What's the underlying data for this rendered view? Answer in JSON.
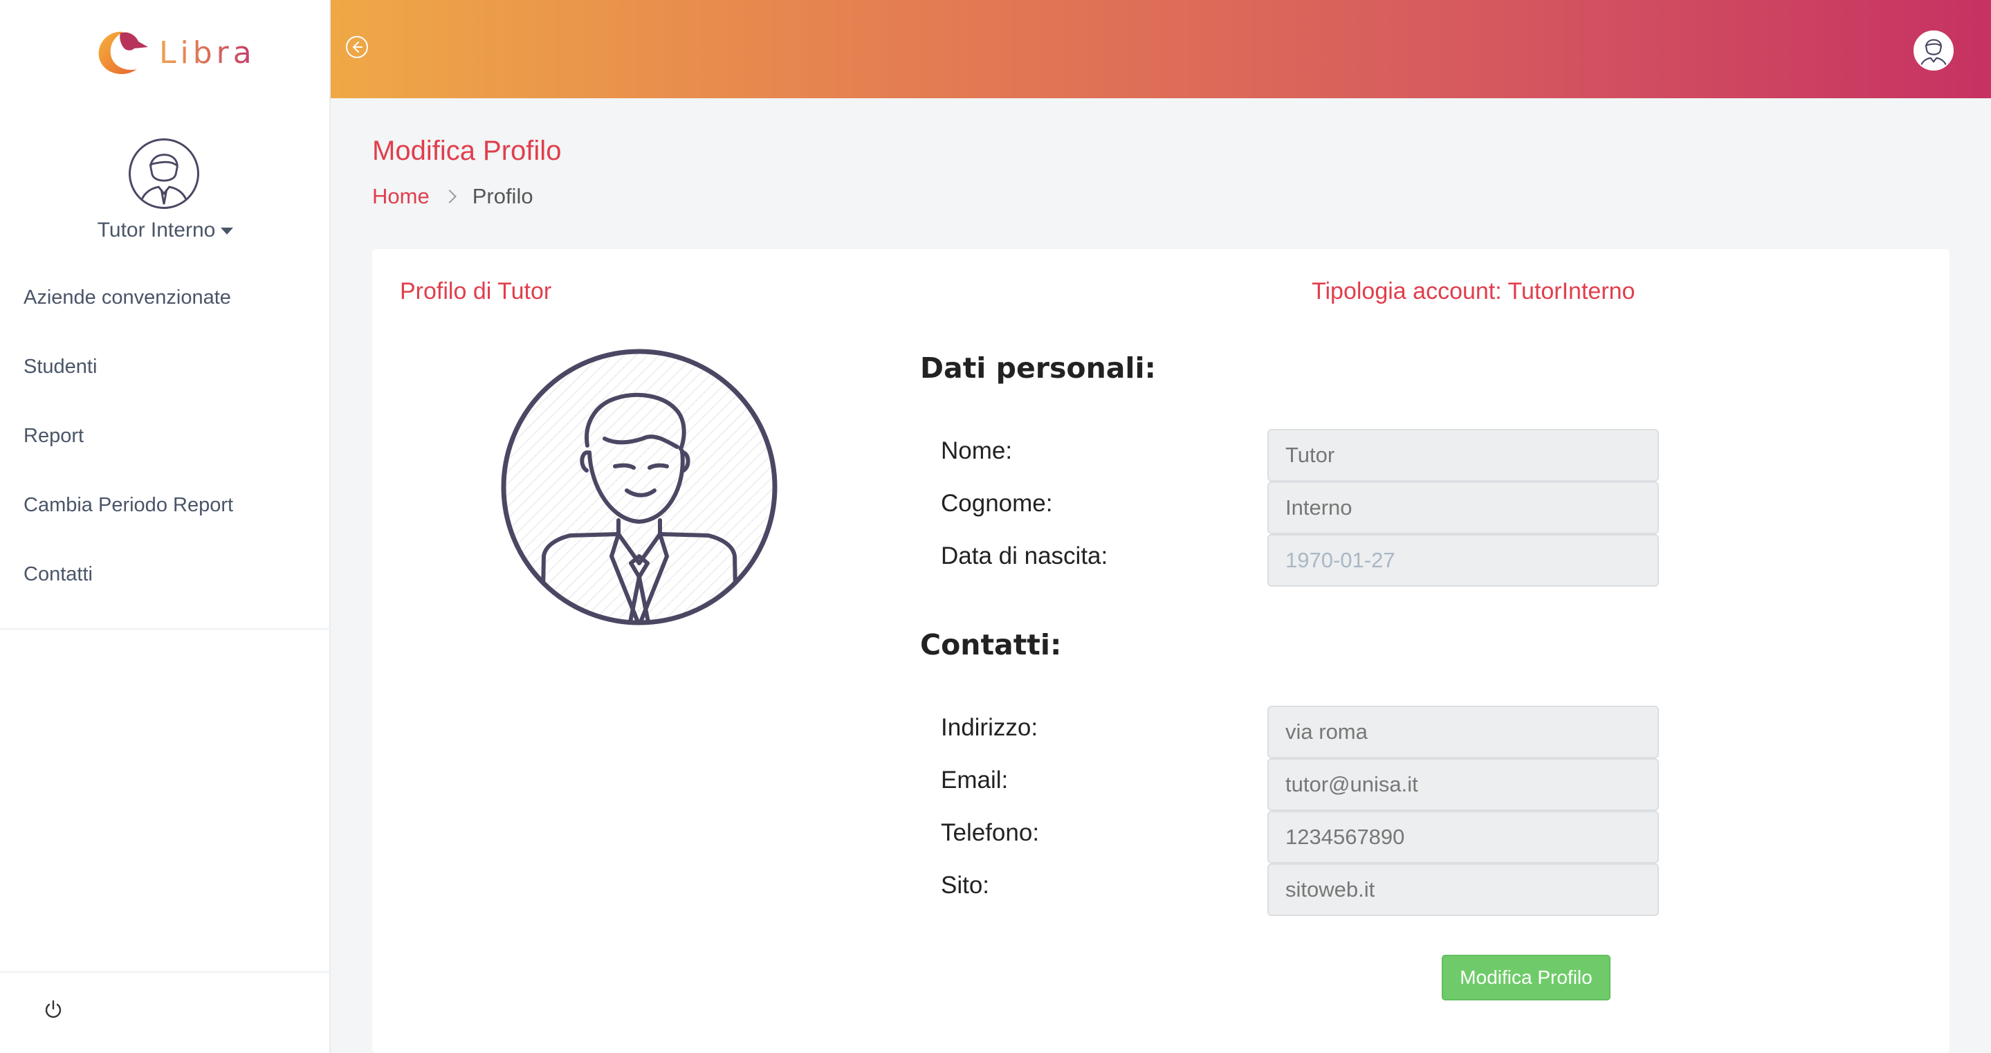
{
  "app": {
    "logo_text": "Libra"
  },
  "sidebar": {
    "user_name": "Tutor Interno",
    "items": [
      {
        "label": "Aziende convenzionate"
      },
      {
        "label": "Studenti"
      },
      {
        "label": "Report"
      },
      {
        "label": "Cambia Periodo Report"
      },
      {
        "label": "Contatti"
      }
    ],
    "footer_icon": "power-icon"
  },
  "header": {
    "back_icon": "arrow-left-circle-icon",
    "avatar_icon": "user-avatar-icon",
    "gradient": [
      "#efa846",
      "#c63262"
    ]
  },
  "page": {
    "title": "Modifica Profilo",
    "breadcrumb": {
      "home": "Home",
      "current": "Profilo"
    }
  },
  "card": {
    "title": "Profilo di Tutor",
    "account_type": "Tipologia account: TutorInterno",
    "personal_heading": "Dati personali:",
    "personal_fields": [
      {
        "label": "Nome:",
        "value": "Tutor"
      },
      {
        "label": "Cognome:",
        "value": "Interno"
      },
      {
        "label": "Data di nascita:",
        "value": "1970-01-27"
      }
    ],
    "contacts_heading": "Contatti:",
    "contact_fields": [
      {
        "label": "Indirizzo:",
        "value": "via roma"
      },
      {
        "label": "Email:",
        "value": "tutor@unisa.it"
      },
      {
        "label": "Telefono:",
        "value": "1234567890"
      },
      {
        "label": "Sito:",
        "value": "sitoweb.it"
      }
    ],
    "submit_label": "Modifica Profilo"
  },
  "colors": {
    "accent": "#e03e4c",
    "button": "#6fcb6a"
  }
}
